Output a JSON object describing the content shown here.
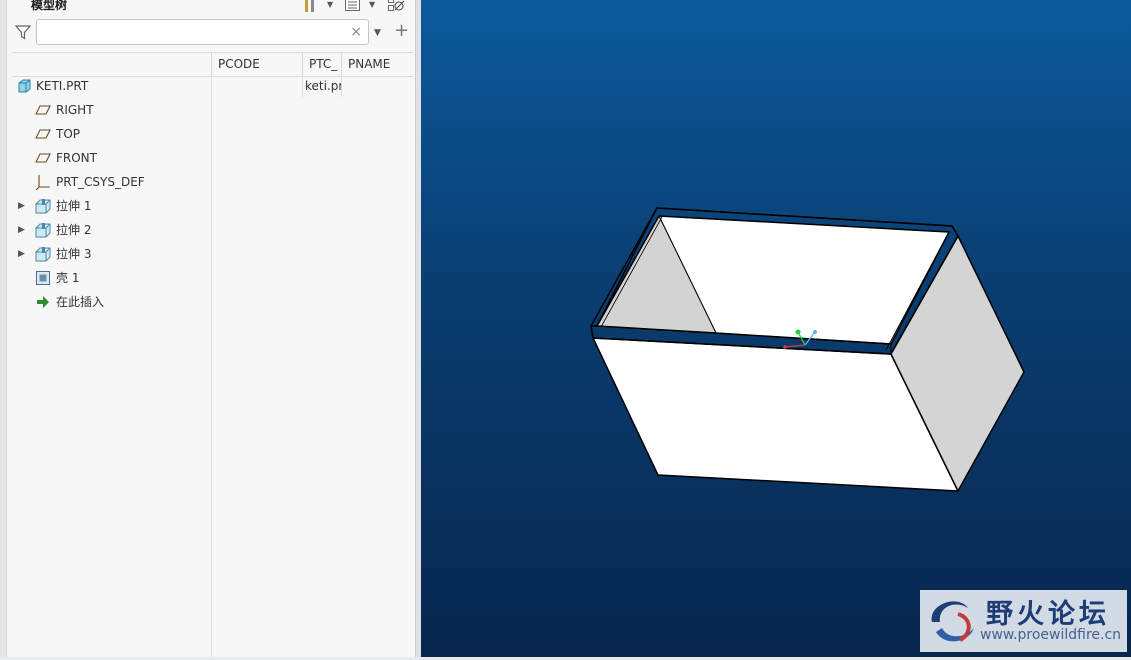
{
  "panel": {
    "title": "模型树",
    "search": {
      "value": "",
      "placeholder": ""
    },
    "clear_glyph": "×"
  },
  "columns": [
    "PCODE",
    "PTC_",
    "PNAME"
  ],
  "tree": [
    {
      "label": "KETI.PRT",
      "icon": "part-icon",
      "ptc": "keti.pr",
      "expandable": false
    },
    {
      "label": "RIGHT",
      "icon": "datum-plane-icon",
      "expandable": false
    },
    {
      "label": "TOP",
      "icon": "datum-plane-icon",
      "expandable": false
    },
    {
      "label": "FRONT",
      "icon": "datum-plane-icon",
      "expandable": false
    },
    {
      "label": "PRT_CSYS_DEF",
      "icon": "csys-icon",
      "expandable": false
    },
    {
      "label": "拉伸 1",
      "icon": "extrude-icon",
      "expandable": true
    },
    {
      "label": "拉伸 2",
      "icon": "extrude-icon",
      "expandable": true
    },
    {
      "label": "拉伸 3",
      "icon": "extrude-icon",
      "expandable": true
    },
    {
      "label": "壳 1",
      "icon": "shell-icon",
      "expandable": false
    },
    {
      "label": "在此插入",
      "icon": "insert-here-icon",
      "expandable": false
    }
  ],
  "watermark": {
    "title": "野火论坛",
    "url": "www.proewildfire.cn"
  },
  "colors": {
    "viewport_top": "#0c5a9c",
    "viewport_bottom": "#08264e",
    "insert_arrow": "#2e8b2e"
  }
}
